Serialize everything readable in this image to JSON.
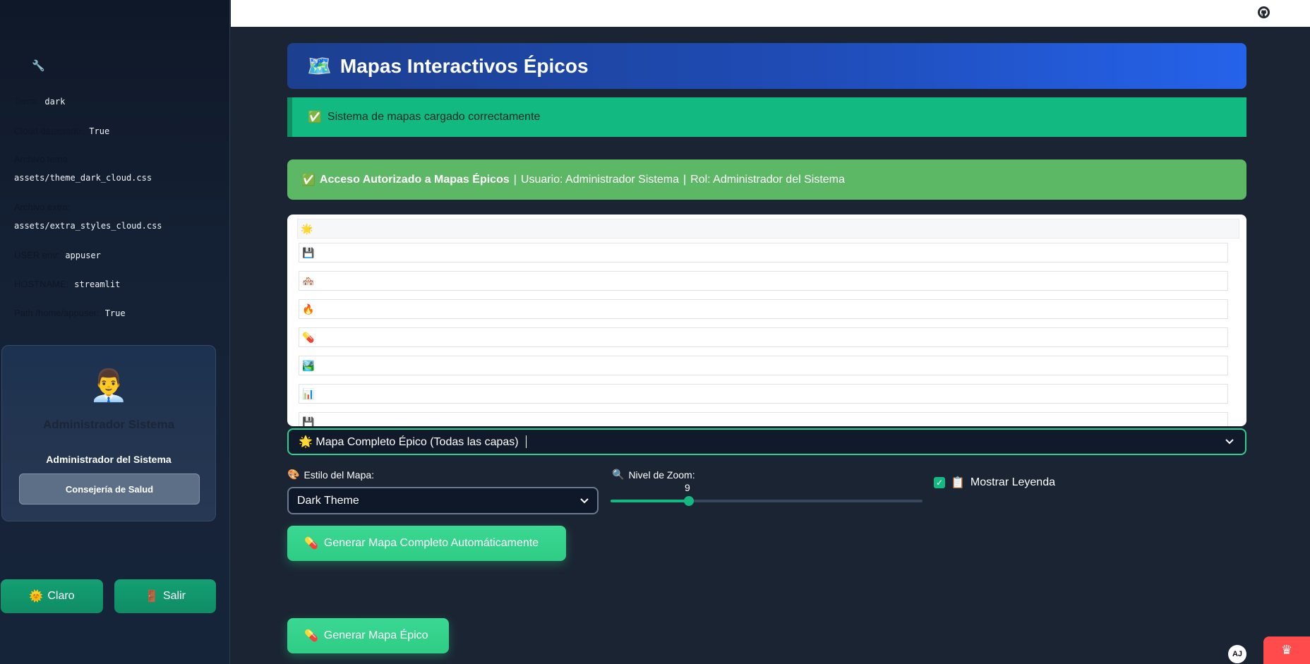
{
  "sidebar": {
    "wrench_icon": "🔧",
    "debug": [
      {
        "key": "Tema:",
        "value": "dark"
      },
      {
        "key": "Cloud detectado:",
        "value": "True"
      },
      {
        "key": "Archivo tema:",
        "value": "assets/theme_dark_cloud.css"
      },
      {
        "key": "Archivo extra:",
        "value": "assets/extra_styles_cloud.css"
      },
      {
        "key": "USER env:",
        "value": "appuser"
      },
      {
        "key": "HOSTNAME:",
        "value": "streamlit"
      },
      {
        "key": "Path /home/appuser:",
        "value": "True"
      }
    ],
    "user": {
      "avatar": "👨‍💼",
      "name": "Administrador Sistema",
      "role": "Administrador del Sistema",
      "department": "Consejería de Salud"
    },
    "buttons": {
      "claro_icon": "🌞",
      "claro": "Claro",
      "salir_icon": "🚪",
      "salir": "Salir"
    }
  },
  "topbar": {
    "github_icon": "github-icon"
  },
  "main": {
    "hero_icon": "🗺️",
    "hero_title": "Mapas Interactivos Épicos",
    "success_icon": "✅",
    "success_text": "Sistema de mapas cargado correctamente",
    "access": {
      "icon": "✅",
      "bold": "Acceso Autorizado a Mapas Épicos",
      "sep1": "|",
      "user": "Usuario: Administrador Sistema",
      "sep2": "|",
      "role": "Rol: Administrador del Sistema"
    },
    "options": [
      "🌟",
      "💾",
      "🏘️",
      "🔥",
      "💊",
      "🏞️",
      "📊",
      "💾"
    ],
    "selected_option": "🌟 Mapa Completo Épico (Todas las capas)",
    "style_label_icon": "🎨",
    "style_label": "Estilo del Mapa:",
    "style_value": "Dark Theme",
    "zoom_label_icon": "🔍",
    "zoom_label": "Nivel de Zoom:",
    "zoom_value": "9",
    "zoom_fraction": 0.25,
    "legend_icon": "📋",
    "legend_label": "Mostrar Leyenda",
    "legend_checked": "✓",
    "gen_full_icon": "💊",
    "gen_full_label": "Generar Mapa Completo Automáticamente",
    "gen_epic_icon": "💊",
    "gen_epic_label": "Generar Mapa Épico"
  },
  "corner": {
    "avatar_text": "AJ",
    "crown": "♛"
  },
  "colors": {
    "accent": "#12b981",
    "hero_start": "#1c3f8f",
    "hero_end": "#2563eb",
    "access_bg": "#5db866",
    "badge": "#ff4b4b"
  }
}
